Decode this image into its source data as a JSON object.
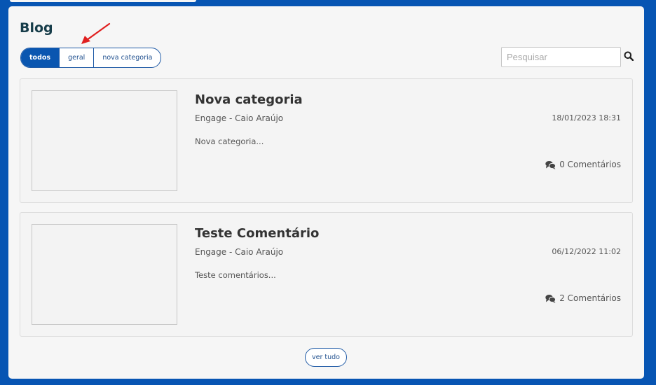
{
  "blog": {
    "title": "Blog"
  },
  "filters": [
    {
      "label": "todos",
      "active": true
    },
    {
      "label": "geral",
      "active": false
    },
    {
      "label": "nova categoria",
      "active": false
    }
  ],
  "search": {
    "placeholder": "Pesquisar",
    "value": "",
    "icon": "search-icon"
  },
  "annotation": {
    "color": "#e02020",
    "icon": "red-arrow"
  },
  "posts": [
    {
      "title": "Nova categoria",
      "author": "Engage - Caio Araújo",
      "date": "18/01/2023 18:31",
      "excerpt": "Nova categoria...",
      "comments": "0 Comentários"
    },
    {
      "title": "Teste Comentário",
      "author": "Engage - Caio Araújo",
      "date": "06/12/2022 11:02",
      "excerpt": "Teste comentários...",
      "comments": "2 Comentários"
    }
  ],
  "see_all": {
    "label": "ver tudo"
  },
  "colors": {
    "background": "#0755b3",
    "panel": "#f6f6f6",
    "accent": "#0a56b0",
    "title": "#173d4a",
    "arrow": "#e02020"
  }
}
